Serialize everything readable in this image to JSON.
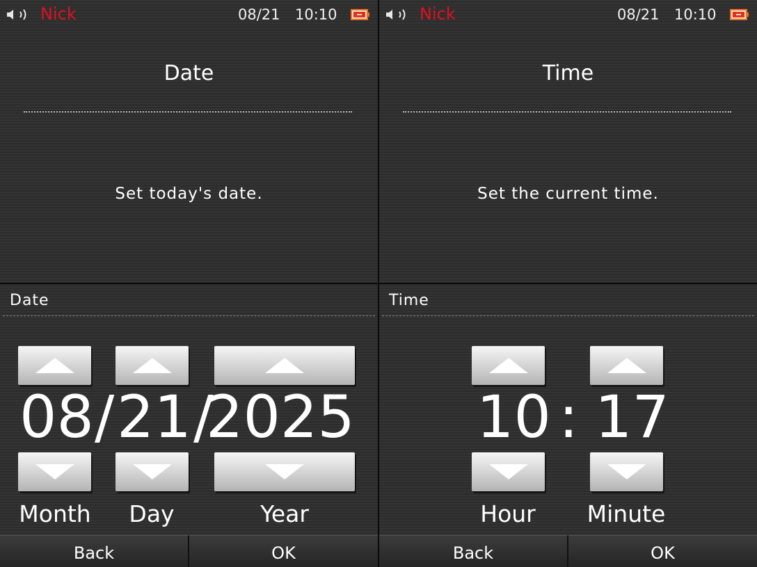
{
  "status": {
    "user": "Nick",
    "date": "08/21",
    "time": "10:10",
    "speaker_icon": "speaker-icon",
    "battery_icon": "battery-icon",
    "user_color": "#e01020"
  },
  "date_screen": {
    "title": "Date",
    "message": "Set today's date.",
    "panel_label": "Date",
    "month": "08",
    "sep1": "/",
    "day": "21",
    "sep2": "/",
    "year": "2025",
    "labels": {
      "month": "Month",
      "day": "Day",
      "year": "Year"
    },
    "back": "Back",
    "ok": "OK"
  },
  "time_screen": {
    "title": "Time",
    "message": "Set the current time.",
    "panel_label": "Time",
    "hour": "10",
    "colon": ":",
    "minute": "17",
    "labels": {
      "hour": "Hour",
      "minute": "Minute"
    },
    "back": "Back",
    "ok": "OK"
  }
}
